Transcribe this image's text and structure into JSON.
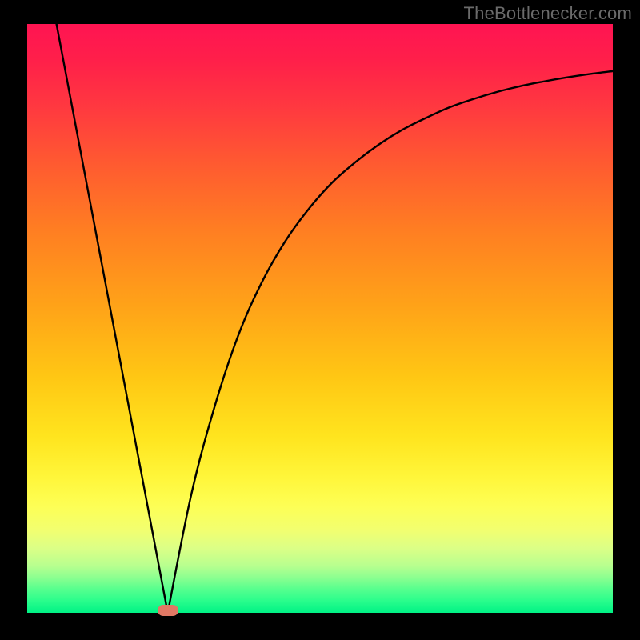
{
  "attribution": "TheBottlenecker.com",
  "colors": {
    "curve": "#000000",
    "bump": "#e07864",
    "frame": "#000000"
  },
  "chart_data": {
    "type": "line",
    "title": "",
    "xlabel": "",
    "ylabel": "",
    "xlim": [
      0,
      100
    ],
    "ylim": [
      0,
      100
    ],
    "annotations": [
      {
        "kind": "marker",
        "shape": "pill",
        "x": 24,
        "y": 0
      }
    ],
    "series": [
      {
        "name": "left-slope",
        "x": [
          5,
          24
        ],
        "y": [
          100,
          0
        ]
      },
      {
        "name": "right-curve",
        "x": [
          24,
          28,
          32,
          36,
          40,
          44,
          48,
          52,
          56,
          60,
          64,
          68,
          72,
          76,
          80,
          84,
          88,
          92,
          96,
          100
        ],
        "y": [
          0,
          20,
          35,
          47,
          56,
          63,
          68.5,
          73,
          76.5,
          79.5,
          82,
          84,
          85.8,
          87.2,
          88.4,
          89.4,
          90.2,
          90.9,
          91.5,
          92
        ]
      }
    ]
  }
}
